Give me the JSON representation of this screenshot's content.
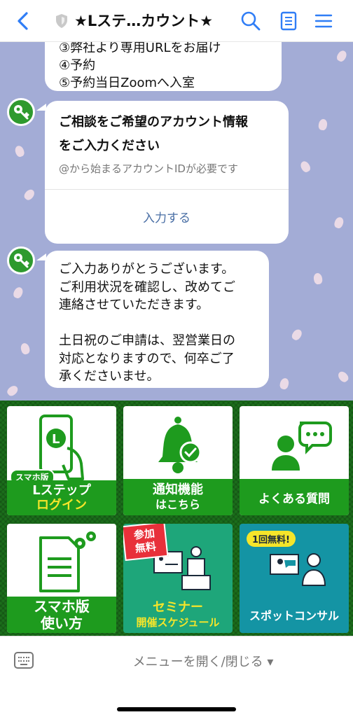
{
  "header": {
    "title": "★Lステ…カウント★"
  },
  "chat": {
    "messages": [
      {
        "text": "③弊社より専用URLをお届け\n④予約\n⑤予約当日Zoomへ入室"
      },
      {
        "title": "ご相談をご希望のアカウント情報\nをご入力ください",
        "subtitle": "@から始まるアカウントIDが必要です",
        "action": "入力する"
      },
      {
        "text": "ご入力ありがとうございます。\nご利用状況を確認し、改めてご\n連絡させていただきます。\n\n土日祝のご申請は、翌営業日の\n対応となりますので、何卒ご了\n承くださいませ。"
      }
    ]
  },
  "rich_menu": {
    "tiles": [
      {
        "badge": "スマホ版",
        "line1": "Lステップ",
        "line2": "ログイン"
      },
      {
        "line1": "通知機能",
        "line2": "はこちら"
      },
      {
        "line1": "よくある質問"
      },
      {
        "line1": "スマホ版",
        "line2": "使い方"
      },
      {
        "badge1": "参加",
        "badge2": "無料",
        "line1": "セミナー",
        "line2": "開催スケジュール"
      },
      {
        "badge": "1回無料!",
        "line1": "スポットコンサル"
      }
    ]
  },
  "footer": {
    "menu_toggle": "メニューを開く/閉じる ▾"
  },
  "colors": {
    "chat_bg": "#a3acd6",
    "menu_green": "#1e9b1e",
    "accent_blue": "#2f7df6",
    "highlight_yellow": "#f5e52a"
  }
}
